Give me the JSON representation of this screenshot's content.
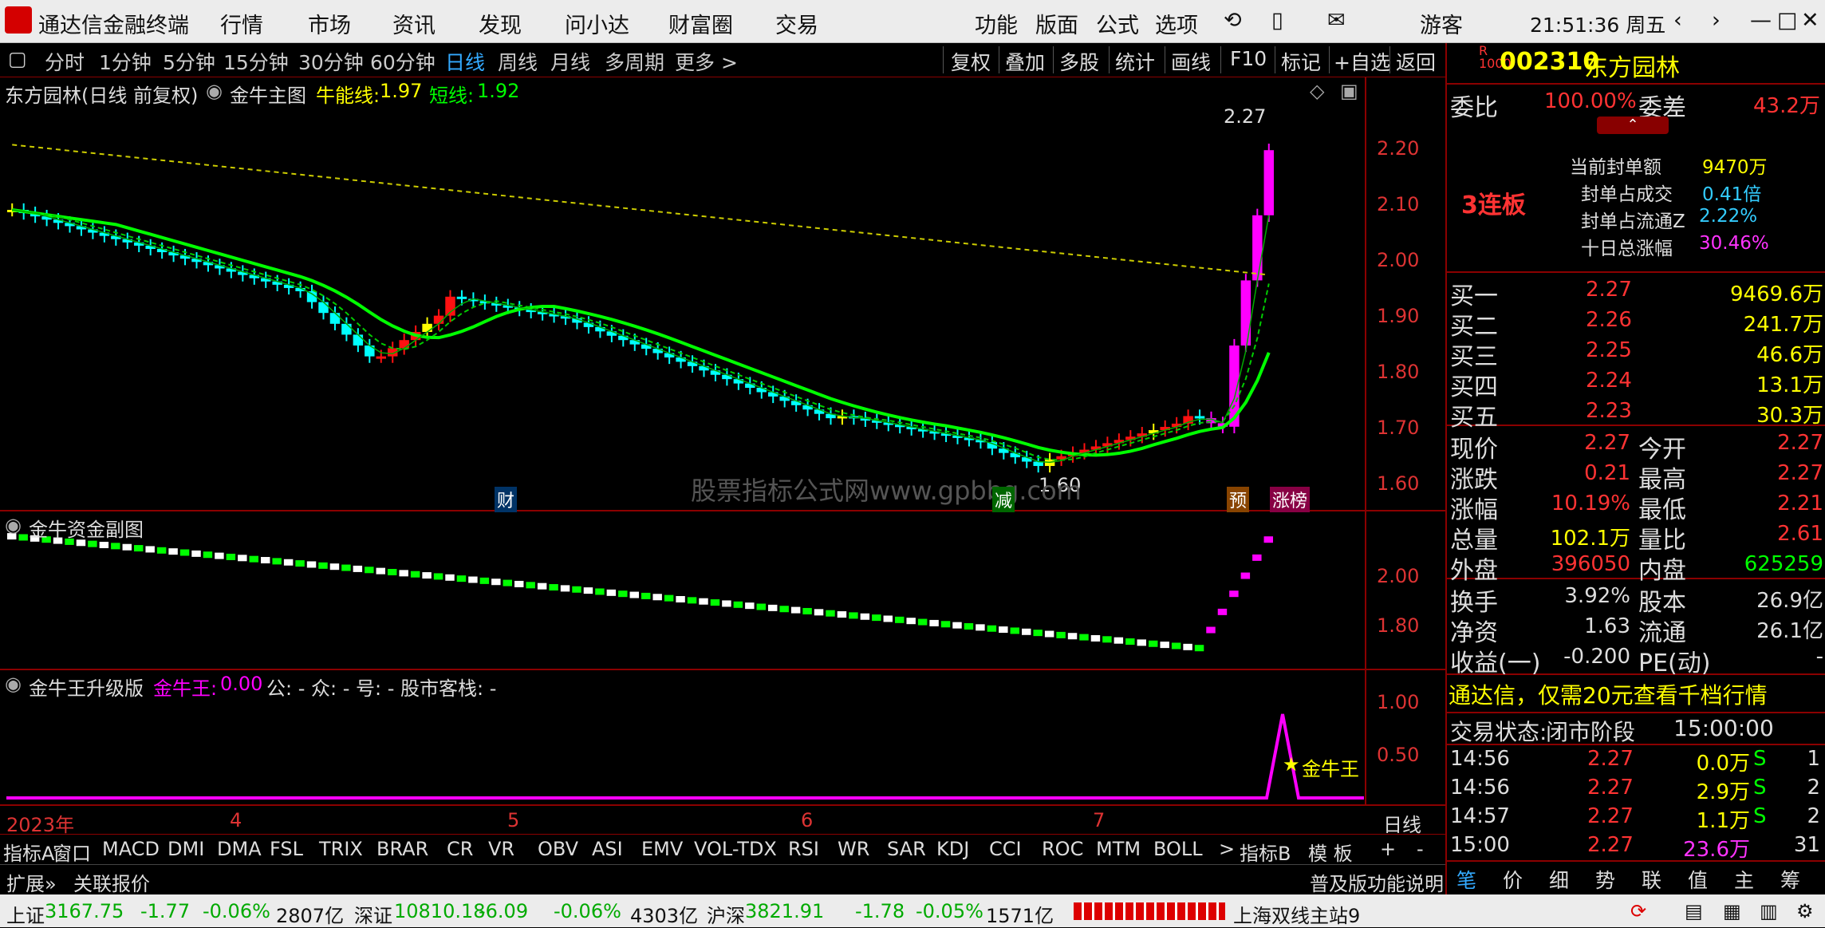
{
  "app": {
    "title": "通达信金融终端",
    "menu": [
      "行情",
      "市场",
      "资讯",
      "发现",
      "问小达",
      "财富圈",
      "交易"
    ],
    "right_menu": [
      "功能",
      "版面",
      "公式",
      "选项"
    ],
    "user": "游客",
    "clock": "21:51:36 周五"
  },
  "toolbar": {
    "periods": [
      "分时",
      "1分钟",
      "5分钟",
      "15分钟",
      "30分钟",
      "60分钟",
      "日线",
      "周线",
      "月线",
      "多周期",
      "更多 >"
    ],
    "active": "日线",
    "right": [
      "复权",
      "叠加",
      "多股",
      "统计",
      "画线",
      "F10",
      "标记",
      "+自选",
      "返回"
    ]
  },
  "main_chart": {
    "title": "东方园林(日线 前复权)",
    "indicator": "金牛主图",
    "niu_label": "牛能线:",
    "niu_value": "1.97",
    "short_label": "短线:",
    "short_value": "1.92",
    "price_axis": [
      "2.20",
      "2.10",
      "2.00",
      "1.90",
      "1.80",
      "1.70",
      "1.60"
    ],
    "high_note": "2.27",
    "low_note": "1.60",
    "markers": [
      "财",
      "减",
      "预",
      "涨榜"
    ],
    "watermark": "股票指标公式网www.gpbbg.com"
  },
  "sub1": {
    "title": "金牛资金副图",
    "axis": [
      "2.00",
      "1.80"
    ]
  },
  "sub2": {
    "title": "金牛王升级版",
    "jnw_label": "金牛王:",
    "jnw_value": "0.00",
    "rest": "公: -  众: -  号: -  股市客栈: -",
    "axis": [
      "1.00",
      "0.50"
    ],
    "star_label": "金牛王"
  },
  "xaxis": {
    "labels": [
      "2023年",
      "4",
      "5",
      "6",
      "7"
    ],
    "period": "日线"
  },
  "chart_data": {
    "type": "candlestick",
    "series_name": "东方园林",
    "close_last": 2.27,
    "ylim": [
      1.55,
      2.3
    ],
    "niu": 1.97,
    "short": 1.92
  },
  "indicator_tabs": [
    "指标A",
    "窗口",
    "MACD",
    "DMI",
    "DMA",
    "FSL",
    "TRIX",
    "BRAR",
    "CR",
    "VR",
    "OBV",
    "ASI",
    "EMV",
    "VOL-TDX",
    "RSI",
    "WR",
    "SAR",
    "KDJ",
    "CCI",
    "ROC",
    "MTM",
    "BOLL",
    ">"
  ],
  "indicator_tabs_right": [
    "指标B",
    "模 板",
    "+",
    "-"
  ],
  "bottom_row2": {
    "left": [
      "扩展»",
      "关联报价"
    ],
    "right": "普及版功能说明"
  },
  "quote": {
    "code": "002310",
    "name": "东方园林",
    "weibi_label": "委比",
    "weibi": "100.00%",
    "weicha_label": "委差",
    "weicha": "43.2万",
    "lianban": "3连板",
    "seal": [
      {
        "k": "当前封单额",
        "v": "9470万"
      },
      {
        "k": "封单占成交",
        "v": "0.41倍"
      },
      {
        "k": "封单占流通Z",
        "v": "2.22%"
      },
      {
        "k": "十日总涨幅",
        "v": "30.46%"
      }
    ],
    "bids": [
      {
        "l": "买一",
        "p": "2.27",
        "v": "9469.6万"
      },
      {
        "l": "买二",
        "p": "2.26",
        "v": "241.7万"
      },
      {
        "l": "买三",
        "p": "2.25",
        "v": "46.6万"
      },
      {
        "l": "买四",
        "p": "2.24",
        "v": "13.1万"
      },
      {
        "l": "买五",
        "p": "2.23",
        "v": "30.3万"
      }
    ],
    "stats": [
      {
        "l": "现价",
        "v": "2.27",
        "l2": "今开",
        "v2": "2.27"
      },
      {
        "l": "涨跌",
        "v": "0.21",
        "l2": "最高",
        "v2": "2.27"
      },
      {
        "l": "涨幅",
        "v": "10.19%",
        "l2": "最低",
        "v2": "2.21"
      },
      {
        "l": "总量",
        "v": "102.1万",
        "l2": "量比",
        "v2": "2.61"
      },
      {
        "l": "外盘",
        "v": "396050",
        "l2": "内盘",
        "v2": "625259"
      }
    ],
    "stats2": [
      {
        "l": "换手",
        "v": "3.92%",
        "l2": "股本",
        "v2": "26.9亿"
      },
      {
        "l": "净资",
        "v": "1.63",
        "l2": "流通",
        "v2": "26.1亿"
      },
      {
        "l": "收益(一)",
        "v": "-0.200",
        "l2": "PE(动)",
        "v2": "-"
      }
    ],
    "ad": "通达信，仅需20元查看千档行情",
    "state_label": "交易状态:",
    "state": "闭市阶段",
    "state_time": "15:00:00",
    "ticks": [
      {
        "t": "14:56",
        "p": "2.27",
        "v": "0.0万",
        "d": "S",
        "n": "1"
      },
      {
        "t": "14:56",
        "p": "2.27",
        "v": "2.9万",
        "d": "S",
        "n": "2"
      },
      {
        "t": "14:57",
        "p": "2.27",
        "v": "1.1万",
        "d": "S",
        "n": "2"
      },
      {
        "t": "15:00",
        "p": "2.27",
        "v": "23.6万",
        "d": "",
        "n": "31"
      }
    ],
    "tabs": [
      "笔",
      "价",
      "细",
      "势",
      "联",
      "值",
      "主",
      "筹"
    ]
  },
  "status": {
    "sh_label": "上证",
    "sh": "3167.75",
    "sh_chg": "-1.77",
    "sh_pct": "-0.06%",
    "sh_amt": "2807亿",
    "sz_label": "深证",
    "sz": "10810.18",
    "sz_chg": "-6.09",
    "sz_pct": "-0.06%",
    "sz_amt": "4303亿",
    "hs_label": "沪深",
    "hs": "3821.91",
    "hs_chg": "-1.78",
    "hs_pct": "-0.05%",
    "hs_amt": "1571亿",
    "server": "上海双线主站9"
  }
}
